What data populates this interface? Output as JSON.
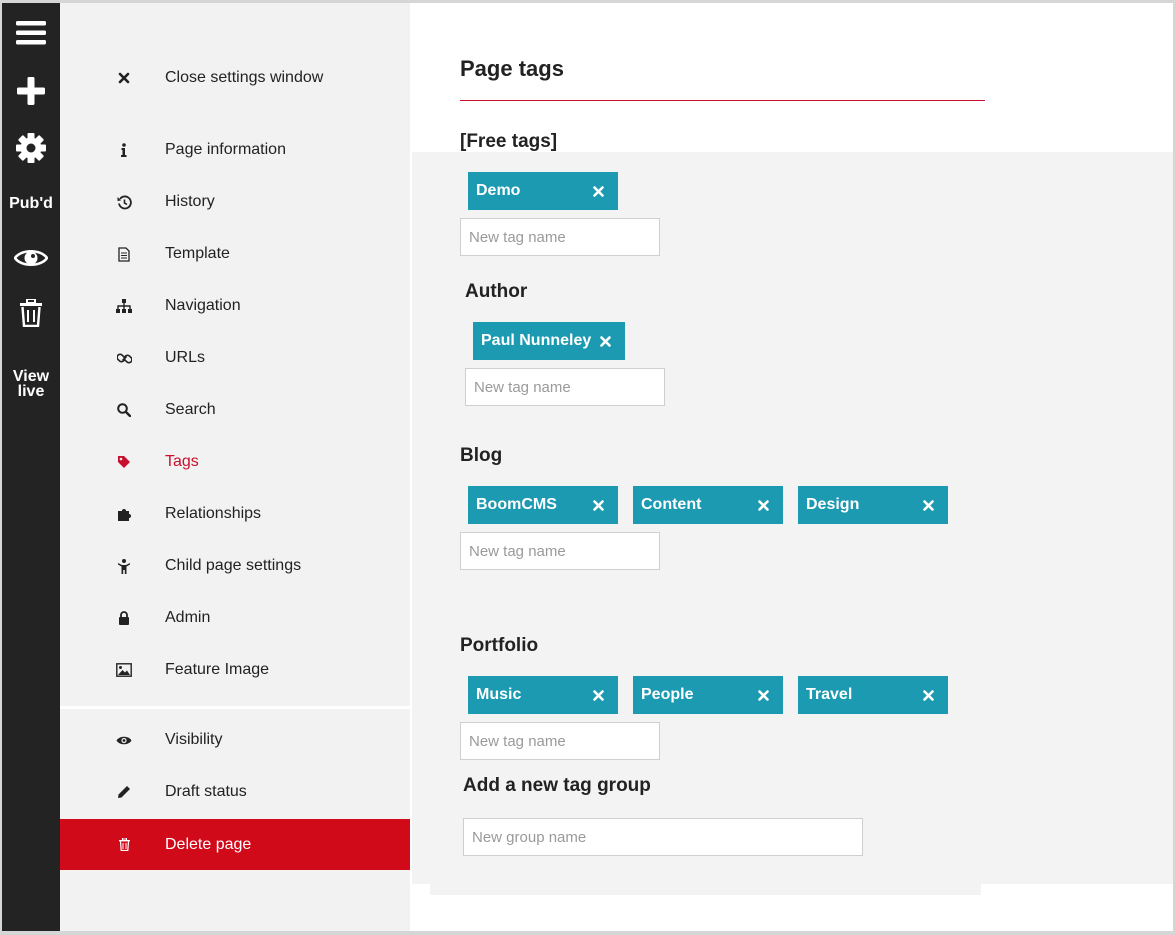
{
  "toolbar": {
    "menu_icon": "hamburger-icon",
    "add_icon": "plus-icon",
    "settings_icon": "gear-icon",
    "publish_label": "Pub'd",
    "preview_icon": "eye-icon",
    "delete_icon": "trash-icon",
    "view_live_line1": "View",
    "view_live_line2": "live"
  },
  "menu": {
    "items": [
      {
        "icon": "close-icon",
        "label": "Close settings window"
      },
      {
        "icon": "info-icon",
        "label": "Page information"
      },
      {
        "icon": "history-icon",
        "label": "History"
      },
      {
        "icon": "document-icon",
        "label": "Template"
      },
      {
        "icon": "sitemap-icon",
        "label": "Navigation"
      },
      {
        "icon": "link-icon",
        "label": "URLs"
      },
      {
        "icon": "search-icon",
        "label": "Search"
      },
      {
        "icon": "tag-icon",
        "label": "Tags",
        "active": true
      },
      {
        "icon": "puzzle-icon",
        "label": "Relationships"
      },
      {
        "icon": "child-icon",
        "label": "Child page settings"
      },
      {
        "icon": "lock-icon",
        "label": "Admin"
      },
      {
        "icon": "image-icon",
        "label": "Feature Image"
      }
    ],
    "secondary": [
      {
        "icon": "eye-icon",
        "label": "Visibility"
      },
      {
        "icon": "pencil-icon",
        "label": "Draft status"
      },
      {
        "icon": "trash-icon",
        "label": "Delete page"
      }
    ]
  },
  "main": {
    "title": "Page tags",
    "accent_color": "#c8102e",
    "tag_color": "#1c9ab2",
    "groups": [
      {
        "name": "[Free tags]",
        "tags": [
          "Demo"
        ],
        "placeholder": "New tag name"
      },
      {
        "name": "Author",
        "tags": [
          "Paul Nunneley"
        ],
        "placeholder": "New tag name"
      },
      {
        "name": "Blog",
        "tags": [
          "BoomCMS",
          "Content",
          "Design"
        ],
        "placeholder": "New tag name"
      },
      {
        "name": "Portfolio",
        "tags": [
          "Music",
          "People",
          "Travel"
        ],
        "placeholder": "New tag name"
      }
    ],
    "new_group": {
      "title": "Add a new tag group",
      "placeholder": "New group name"
    }
  }
}
